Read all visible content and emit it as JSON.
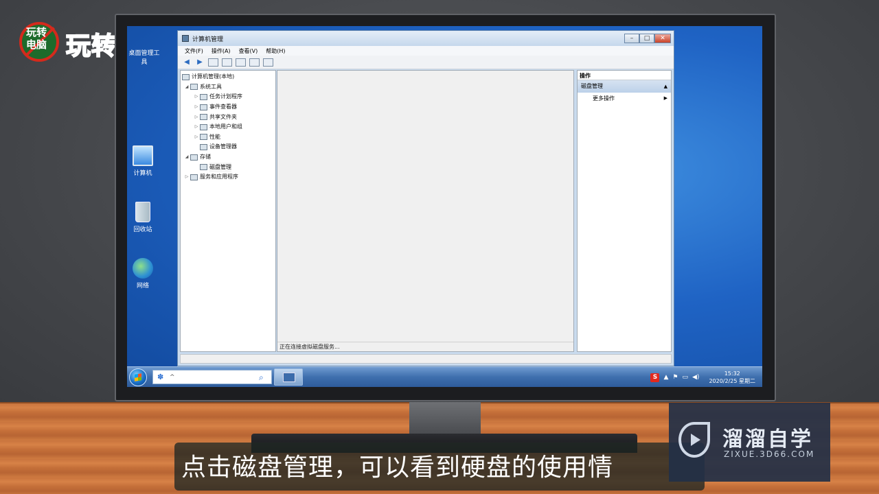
{
  "brand": {
    "badge_top": "玩转",
    "badge_bottom": "电脑",
    "text": "玩转电脑"
  },
  "desktop": {
    "icons": [
      {
        "label": "桌面管理工具",
        "icon": "toolbox-icon"
      },
      {
        "label": "计算机",
        "icon": "computer-icon"
      },
      {
        "label": "回收站",
        "icon": "recycle-bin-icon"
      },
      {
        "label": "网络",
        "icon": "network-icon"
      }
    ]
  },
  "window": {
    "title": "计算机管理",
    "buttons": {
      "minimize": "–",
      "maximize": "□",
      "close": "✕"
    },
    "menu": [
      "文件(F)",
      "操作(A)",
      "查看(V)",
      "帮助(H)"
    ],
    "tree": [
      {
        "label": "计算机管理(本地)",
        "level": 0,
        "expander": ""
      },
      {
        "label": "系统工具",
        "level": 1,
        "expander": "◢"
      },
      {
        "label": "任务计划程序",
        "level": 2,
        "expander": "▷"
      },
      {
        "label": "事件查看器",
        "level": 2,
        "expander": "▷"
      },
      {
        "label": "共享文件夹",
        "level": 2,
        "expander": "▷"
      },
      {
        "label": "本地用户和组",
        "level": 2,
        "expander": "▷"
      },
      {
        "label": "性能",
        "level": 2,
        "expander": "▷"
      },
      {
        "label": "设备管理器",
        "level": 2,
        "expander": ""
      },
      {
        "label": "存储",
        "level": 1,
        "expander": "◢"
      },
      {
        "label": "磁盘管理",
        "level": 2,
        "expander": "",
        "selected": true
      },
      {
        "label": "服务和应用程序",
        "level": 1,
        "expander": "▷"
      }
    ],
    "center_status": "正在连接虚拟磁盘服务...",
    "actions": {
      "header": "操作",
      "section": "磁盘管理",
      "items": [
        "更多操作"
      ]
    }
  },
  "taskbar": {
    "clock_time": "15:32",
    "clock_date": "2020/2/25 星期二",
    "ime": "S"
  },
  "subtitle": "点击磁盘管理，可以看到硬盘的使用情",
  "watermark": {
    "title": "溜溜自学",
    "url": "ZIXUE.3D66.COM"
  }
}
